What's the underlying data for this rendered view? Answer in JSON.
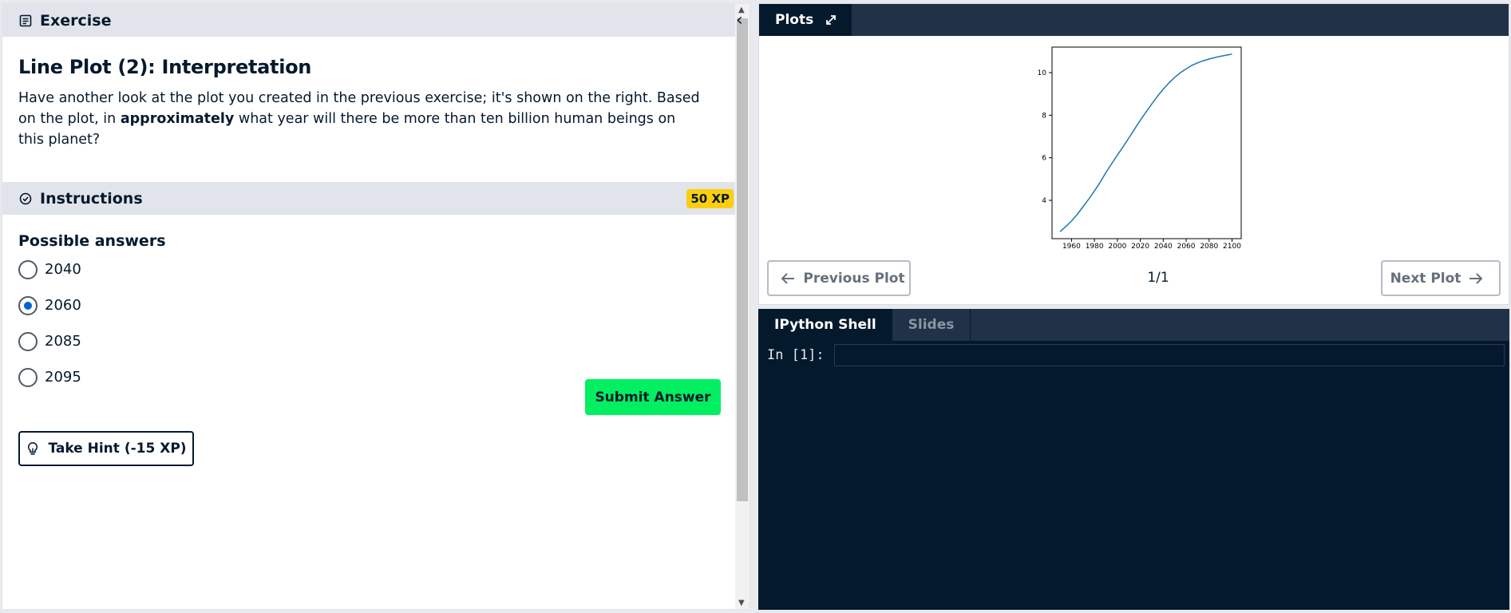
{
  "exercise": {
    "header": "Exercise",
    "title": "Line Plot (2): Interpretation",
    "desc_part1": "Have another look at the plot you created in the previous exercise; it's shown on the right. Based on the plot, in ",
    "desc_bold": "approximately",
    "desc_part2": " what year will there be more than ten billion human beings on this planet?"
  },
  "instructions": {
    "header": "Instructions",
    "xp_badge": "50 XP",
    "answers_title": "Possible answers",
    "options": [
      {
        "label": "2040",
        "selected": false
      },
      {
        "label": "2060",
        "selected": true
      },
      {
        "label": "2085",
        "selected": false
      },
      {
        "label": "2095",
        "selected": false
      }
    ],
    "submit_label": "Submit Answer",
    "hint_label": "Take Hint (-15 XP)"
  },
  "plots": {
    "tab_label": "Plots",
    "prev_label": "Previous Plot",
    "next_label": "Next Plot",
    "counter": "1/1"
  },
  "shell": {
    "tabs": [
      {
        "label": "IPython Shell",
        "active": true
      },
      {
        "label": "Slides",
        "active": false
      }
    ],
    "prompt": "In [1]:",
    "input_value": ""
  },
  "colors": {
    "accent_green": "#03ef62",
    "xp_yellow": "#fcce0d",
    "navy": "#05192d",
    "line_blue": "#1f77b4"
  },
  "chart_data": {
    "type": "line",
    "title": "",
    "xlabel": "",
    "ylabel": "",
    "x": [
      1950,
      1955,
      1960,
      1965,
      1970,
      1975,
      1980,
      1985,
      1990,
      1995,
      2000,
      2005,
      2010,
      2015,
      2020,
      2025,
      2030,
      2035,
      2040,
      2045,
      2050,
      2055,
      2060,
      2065,
      2070,
      2075,
      2080,
      2085,
      2090,
      2095,
      2100
    ],
    "series": [
      {
        "values": [
          2.53,
          2.77,
          3.03,
          3.34,
          3.7,
          4.06,
          4.44,
          4.85,
          5.31,
          5.72,
          6.13,
          6.52,
          6.93,
          7.35,
          7.76,
          8.15,
          8.53,
          8.89,
          9.22,
          9.52,
          9.78,
          10.0,
          10.18,
          10.34,
          10.46,
          10.56,
          10.64,
          10.71,
          10.77,
          10.82,
          10.87
        ]
      }
    ],
    "xticks": [
      "1960",
      "1980",
      "2000",
      "2020",
      "2040",
      "2060",
      "2080",
      "2100"
    ],
    "yticks": [
      "4",
      "6",
      "8",
      "10"
    ],
    "xlim": [
      1943,
      2108
    ],
    "ylim": [
      2.2,
      11.2
    ],
    "grid": false
  }
}
